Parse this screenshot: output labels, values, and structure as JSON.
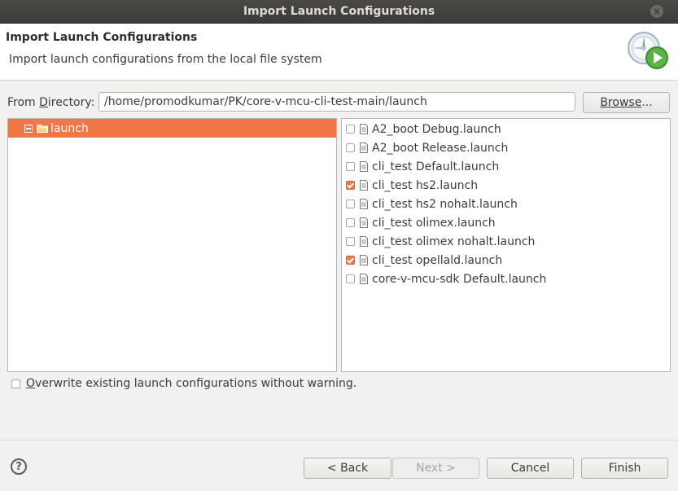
{
  "window": {
    "title": "Import Launch Configurations"
  },
  "banner": {
    "title": "Import Launch Configurations",
    "description": "Import launch configurations from the local file system"
  },
  "directory": {
    "label_prefix": "From ",
    "label_mnemonic": "D",
    "label_suffix": "irectory:",
    "value": "/home/promodkumar/PK/core-v-mcu-cli-test-main/launch",
    "browse_mnemonic": "Browse",
    "browse_suffix": "..."
  },
  "tree": {
    "items": [
      {
        "label": "launch",
        "expanded": true,
        "selected": true
      }
    ]
  },
  "files": [
    {
      "label": "A2_boot Debug.launch",
      "checked": false
    },
    {
      "label": "A2_boot Release.launch",
      "checked": false
    },
    {
      "label": "cli_test Default.launch",
      "checked": false
    },
    {
      "label": "cli_test hs2.launch",
      "checked": true
    },
    {
      "label": "cli_test hs2 nohalt.launch",
      "checked": false
    },
    {
      "label": "cli_test olimex.launch",
      "checked": false
    },
    {
      "label": "cli_test olimex nohalt.launch",
      "checked": false
    },
    {
      "label": "cli_test opellald.launch",
      "checked": true
    },
    {
      "label": "core-v-mcu-sdk Default.launch",
      "checked": false
    }
  ],
  "overwrite": {
    "mnemonic": "O",
    "label_rest": "verwrite existing launch configurations without warning.",
    "checked": false
  },
  "buttons": {
    "back": "< Back",
    "next": "Next >",
    "cancel": "Cancel",
    "finish": "Finish"
  },
  "colors": {
    "accent": "#f07746",
    "titlebar": "#3c3b37"
  },
  "icons": [
    "close-icon",
    "wizard-icon",
    "folder-icon",
    "document-icon",
    "help-icon"
  ]
}
